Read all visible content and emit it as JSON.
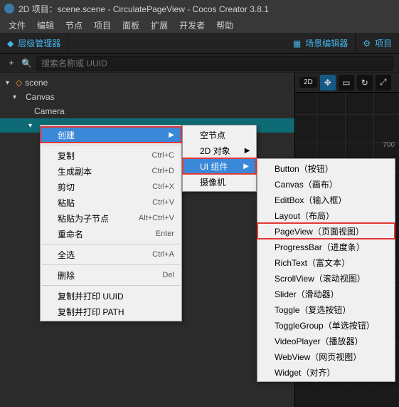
{
  "titlebar": {
    "title": "2D 项目：scene.scene - CirculatePageView - Cocos Creator 3.8.1"
  },
  "menubar": {
    "items": [
      "文件",
      "编辑",
      "节点",
      "项目",
      "面板",
      "扩展",
      "开发者",
      "帮助"
    ]
  },
  "panels": {
    "hierarchy_label": "层级管理器",
    "scene_editor_label": "场景编辑器",
    "project_label": "项目"
  },
  "search": {
    "placeholder": "搜索名称或 UUID"
  },
  "tree": {
    "scene": "scene",
    "canvas": "Canvas",
    "camera": "Camera"
  },
  "scene_toolbar": {
    "mode": "2D"
  },
  "viewport": {
    "ruler_value": "700"
  },
  "context_menu_1": {
    "create": "创建",
    "copy": "复制",
    "generate_copy": "生成副本",
    "cut": "剪切",
    "paste": "粘贴",
    "paste_as_child": "粘贴为子节点",
    "rename": "重命名",
    "select_all": "全选",
    "delete": "删除",
    "copy_print_uuid": "复制并打印 UUID",
    "copy_print_path": "复制并打印 PATH",
    "shortcuts": {
      "copy": "Ctrl+C",
      "generate_copy": "Ctrl+D",
      "cut": "Ctrl+X",
      "paste": "Ctrl+V",
      "paste_as_child": "Alt+Ctrl+V",
      "rename": "Enter",
      "select_all": "Ctrl+A",
      "delete": "Del"
    }
  },
  "context_menu_2": {
    "empty_node": "空节点",
    "obj_2d": "2D 对象",
    "ui_component": "UI 组件",
    "camera": "摄像机"
  },
  "context_menu_3": {
    "items": [
      "Button（按钮）",
      "Canvas（画布）",
      "EditBox（输入框）",
      "Layout（布局）",
      "PageView（页面视图）",
      "ProgressBar（进度条）",
      "RichText（富文本）",
      "ScrollView（滚动视图）",
      "Slider（滑动器）",
      "Toggle（复选按钮）",
      "ToggleGroup（单选按钮）",
      "VideoPlayer（播放器）",
      "WebView（网页视图）",
      "Widget（对齐）"
    ],
    "highlighted_index": 4
  }
}
